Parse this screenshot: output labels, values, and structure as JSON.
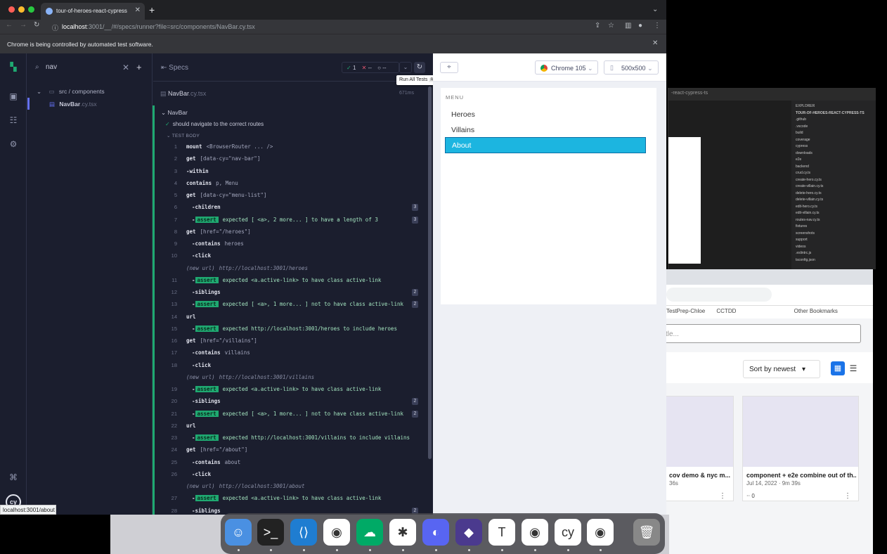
{
  "browser": {
    "tab_title": "tour-of-heroes-react-cypress",
    "url_host": "localhost",
    "url_rest": ":3001/__/#/specs/runner?file=src/components/NavBar.cy.tsx",
    "infobar": "Chrome is being controlled by automated test software.",
    "status_url": "localhost:3001/about"
  },
  "cypress": {
    "search_value": "nav",
    "specs_label": "Specs",
    "stats": {
      "passed": "1",
      "failed": "--",
      "pending": "--"
    },
    "tooltip": "Run All Tests",
    "tooltip_key": "R",
    "tree": {
      "folder": "src / components",
      "file_name": "NavBar",
      "file_ext": ".cy.tsx"
    },
    "spec_file": {
      "name": "NavBar",
      "ext": ".cy.tsx",
      "time": "671ms"
    },
    "suite": "NavBar",
    "test": "should navigate to the correct routes",
    "test_body_label": "TEST BODY",
    "commands": [
      {
        "n": "1",
        "name": "mount",
        "msg": "<BrowserRouter ... />"
      },
      {
        "n": "2",
        "name": "get",
        "msg": "[data-cy=\"nav-bar\"]"
      },
      {
        "n": "3",
        "name": "-within",
        "msg": ""
      },
      {
        "n": "4",
        "name": "contains",
        "msg": "p, Menu"
      },
      {
        "n": "5",
        "name": "get",
        "msg": "[data-cy=\"menu-list\"]"
      },
      {
        "n": "6",
        "name": "-children",
        "msg": "",
        "badge": "3"
      },
      {
        "n": "7",
        "name": "-assert",
        "msg": "expected [ <a>, 2 more... ] to have a length of 3",
        "badge": "3"
      },
      {
        "n": "8",
        "name": "get",
        "msg": "[href=\"/heroes\"]"
      },
      {
        "n": "9",
        "name": "-contains",
        "msg": "heroes"
      },
      {
        "n": "10",
        "name": "-click",
        "msg": ""
      },
      {
        "n": "",
        "name": "(new url)",
        "msg": "http://localhost:3001/heroes"
      },
      {
        "n": "11",
        "name": "-assert",
        "msg": "expected <a.active-link> to have class active-link"
      },
      {
        "n": "12",
        "name": "-siblings",
        "msg": "",
        "badge": "2"
      },
      {
        "n": "13",
        "name": "-assert",
        "msg": "expected [ <a>, 1 more... ] not to have class active-link",
        "badge": "2"
      },
      {
        "n": "14",
        "name": "url",
        "msg": ""
      },
      {
        "n": "15",
        "name": "-assert",
        "msg": "expected http://localhost:3001/heroes to include heroes"
      },
      {
        "n": "16",
        "name": "get",
        "msg": "[href=\"/villains\"]"
      },
      {
        "n": "17",
        "name": "-contains",
        "msg": "villains"
      },
      {
        "n": "18",
        "name": "-click",
        "msg": ""
      },
      {
        "n": "",
        "name": "(new url)",
        "msg": "http://localhost:3001/villains"
      },
      {
        "n": "19",
        "name": "-assert",
        "msg": "expected <a.active-link> to have class active-link"
      },
      {
        "n": "20",
        "name": "-siblings",
        "msg": "",
        "badge": "2"
      },
      {
        "n": "21",
        "name": "-assert",
        "msg": "expected [ <a>, 1 more... ] not to have class active-link",
        "badge": "2"
      },
      {
        "n": "22",
        "name": "url",
        "msg": ""
      },
      {
        "n": "23",
        "name": "-assert",
        "msg": "expected http://localhost:3001/villains to include villains"
      },
      {
        "n": "24",
        "name": "get",
        "msg": "[href=\"/about\"]"
      },
      {
        "n": "25",
        "name": "-contains",
        "msg": "about"
      },
      {
        "n": "26",
        "name": "-click",
        "msg": ""
      },
      {
        "n": "",
        "name": "(new url)",
        "msg": "http://localhost:3001/about"
      },
      {
        "n": "27",
        "name": "-assert",
        "msg": "expected <a.active-link> to have class active-link"
      },
      {
        "n": "28",
        "name": "-siblings",
        "msg": "",
        "badge": "2"
      }
    ]
  },
  "aut": {
    "browser": "Chrome 105",
    "viewport": "500x500",
    "menu_label": "MENU",
    "menu_items": [
      "Heroes",
      "Villains",
      "About"
    ],
    "active_item": "About",
    "active_color": "#1cb5e0"
  },
  "background": {
    "bookmarks": [
      "TestPrep-Chloe",
      "CCTDD",
      "Other Bookmarks"
    ],
    "search_placeholder": "tle...",
    "sort": "Sort by newest",
    "cards": [
      {
        "title": "cov demo & nyc m...",
        "sub": "36s"
      },
      {
        "title": "component + e2e combine out of th...",
        "sub": "Jul 14, 2022 · 9m 39s",
        "meta": "0"
      }
    ],
    "vscode": {
      "title": "-react-cypress-ts",
      "explorer": "EXPLORER",
      "root": "TOUR-OF-HEROES-REACT-CYPRESS-TS",
      "files": [
        ".github",
        ".vscode",
        "build",
        "coverage",
        "cypress",
        "downloads",
        "e2e",
        "backend",
        "crud.cy.ts",
        "create-hero.cy.ts",
        "create-villain.cy.ts",
        "delete-hero.cy.ts",
        "delete-villain.cy.ts",
        "edit-hero.cy.ts",
        "edit-villain.cy.ts",
        "routes-nav.cy.ts",
        "fixtures",
        "screenshots",
        "support",
        "videos",
        ".eslintrc.js",
        "tsconfig.json"
      ]
    }
  },
  "icon_names": [
    "finder-icon",
    "terminal-icon",
    "vscode-icon",
    "chrome-icon",
    "cloud-icon",
    "slack-icon",
    "discord-icon",
    "obsidian-icon",
    "typora-icon",
    "chrome-icon",
    "cypress-icon",
    "chrome-icon",
    "trash-icon"
  ]
}
